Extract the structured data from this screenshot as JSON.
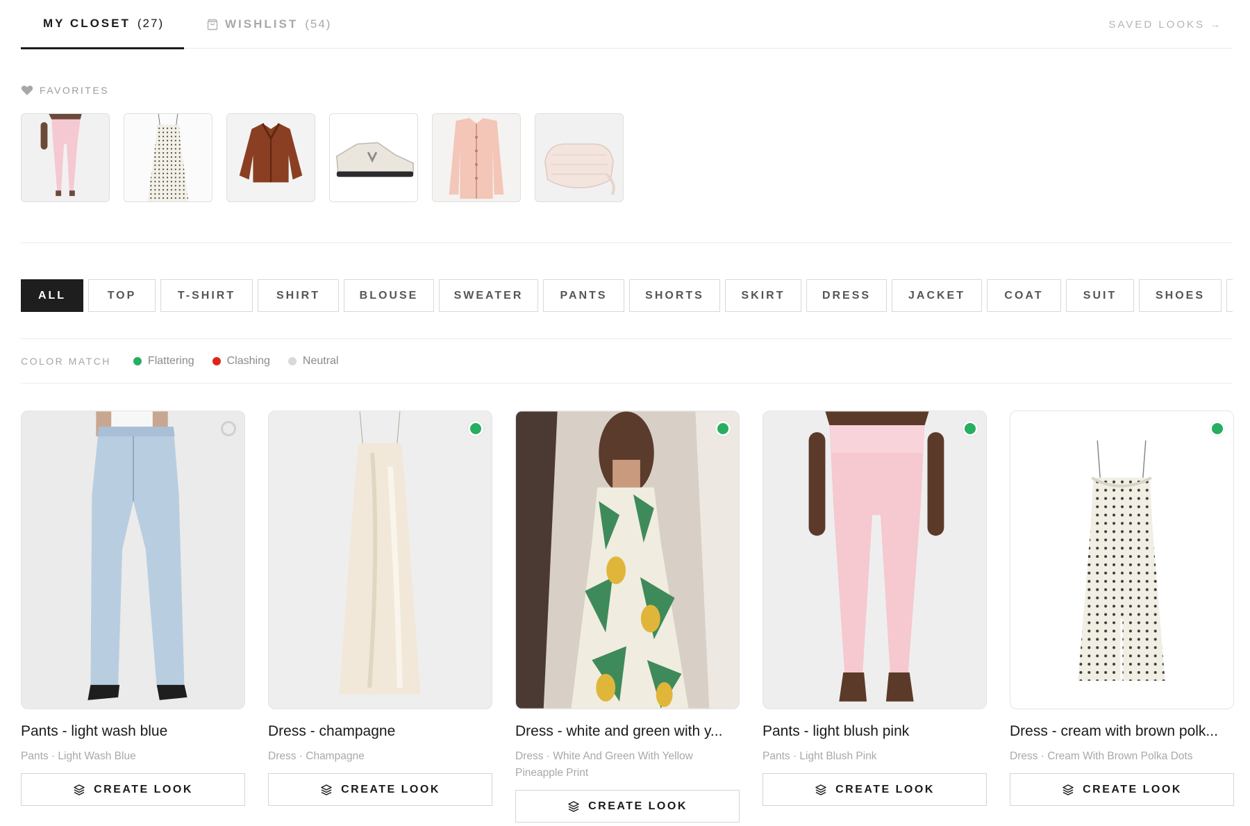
{
  "tabs": {
    "closet": {
      "label": "MY CLOSET",
      "count": "(27)"
    },
    "wishlist": {
      "label": "WISHLIST",
      "count": "(54)",
      "icon": "bag-icon"
    },
    "saved_looks": {
      "label": "SAVED LOOKS",
      "arrow": "→"
    }
  },
  "favorites": {
    "label": "FAVORITES",
    "icon": "heart-icon",
    "items": [
      {
        "name": "pink-leggings"
      },
      {
        "name": "polka-dot-dress"
      },
      {
        "name": "brown-leather-jacket"
      },
      {
        "name": "white-sneakers"
      },
      {
        "name": "peach-cardigan"
      },
      {
        "name": "cream-bag"
      }
    ]
  },
  "categories": [
    "ALL",
    "TOP",
    "T-SHIRT",
    "SHIRT",
    "BLOUSE",
    "SWEATER",
    "PANTS",
    "SHORTS",
    "SKIRT",
    "DRESS",
    "JACKET",
    "COAT",
    "SUIT",
    "SHOES"
  ],
  "active_category": "ALL",
  "color_match": {
    "title": "COLOR MATCH",
    "items": [
      {
        "label": "Flattering",
        "color": "#27ae60"
      },
      {
        "label": "Clashing",
        "color": "#e0241b"
      },
      {
        "label": "Neutral",
        "color": "#d9d9d9"
      }
    ]
  },
  "products": [
    {
      "title": "Pants - light wash blue",
      "subtitle": "Pants · Light Wash Blue",
      "status": "neutral",
      "button": "CREATE LOOK"
    },
    {
      "title": "Dress - champagne",
      "subtitle": "Dress · Champagne",
      "status": "flattering",
      "button": "CREATE LOOK"
    },
    {
      "title": "Dress - white and green with y...",
      "subtitle": "Dress · White And Green With Yellow Pineapple Print",
      "status": "flattering",
      "button": "CREATE LOOK"
    },
    {
      "title": "Pants - light blush pink",
      "subtitle": "Pants · Light Blush Pink",
      "status": "flattering",
      "button": "CREATE LOOK"
    },
    {
      "title": "Dress - cream with brown polk...",
      "subtitle": "Dress · Cream With Brown Polka Dots",
      "status": "flattering",
      "button": "CREATE LOOK"
    }
  ]
}
